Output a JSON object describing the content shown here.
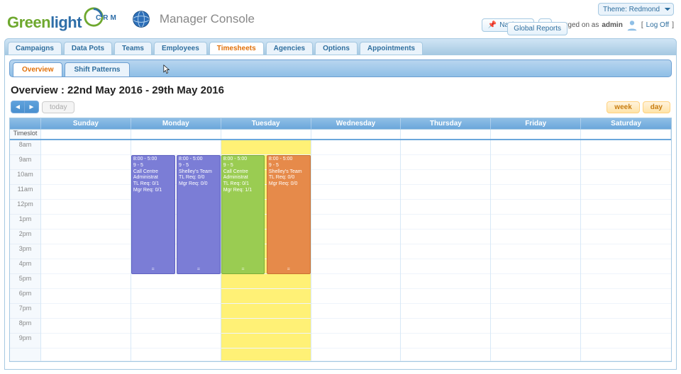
{
  "theme": {
    "label": "Theme:",
    "value": "Redmond"
  },
  "page_title": "Manager Console",
  "logo": {
    "part1": "Green",
    "part2": "light",
    "sub": "CRM"
  },
  "header_buttons": {
    "navigate": "Navigate",
    "global_reports": "Global Reports"
  },
  "login": {
    "prefix": "Logged on as",
    "user": "admin",
    "logoff": "Log Off"
  },
  "top_tabs": {
    "items": [
      "Campaigns",
      "Data Pots",
      "Teams",
      "Employees",
      "Timesheets",
      "Agencies",
      "Options",
      "Appointments"
    ],
    "active_index": 4
  },
  "sub_tabs": {
    "items": [
      "Overview",
      "Shift Patterns"
    ],
    "active_index": 0
  },
  "section_heading": "Overview : 22nd May 2016 - 29th May 2016",
  "toolbar": {
    "prev": "◄",
    "next": "►",
    "today": "today",
    "week": "week",
    "day": "day"
  },
  "calendar": {
    "timeslot_label": "Timeslot",
    "days": [
      "Sunday",
      "Monday",
      "Tuesday",
      "Wednesday",
      "Thursday",
      "Friday",
      "Saturday"
    ],
    "highlight_day_index": 2,
    "hours": [
      "8am",
      "9am",
      "10am",
      "11am",
      "12pm",
      "1pm",
      "2pm",
      "3pm",
      "4pm",
      "5pm",
      "6pm",
      "7pm",
      "8pm",
      "9pm"
    ]
  },
  "events": [
    {
      "day_index": 1,
      "side": "left",
      "color": "blue",
      "time": "8:00 - 5:00",
      "shift": "9 - 5",
      "team": "Call Centre Administrat",
      "tl": "TL Req: 0/1",
      "mgr": "Mgr Req: 0/1"
    },
    {
      "day_index": 1,
      "side": "right",
      "color": "blue",
      "time": "8:00 - 5:00",
      "shift": "9 - 5",
      "team": "Shelley's Team",
      "tl": "TL Req: 0/0",
      "mgr": "Mgr Req: 0/0"
    },
    {
      "day_index": 2,
      "side": "left",
      "color": "green",
      "time": "8:00 - 5:00",
      "shift": "9 - 5",
      "team": "Call Centre Administrat",
      "tl": "TL Req: 0/1",
      "mgr": "Mgr Req: 1/1"
    },
    {
      "day_index": 2,
      "side": "right",
      "color": "orange",
      "time": "8:00 - 5:00",
      "shift": "9 - 5",
      "team": "Shelley's Team",
      "tl": "TL Req: 0/0",
      "mgr": "Mgr Req: 0/0"
    }
  ]
}
